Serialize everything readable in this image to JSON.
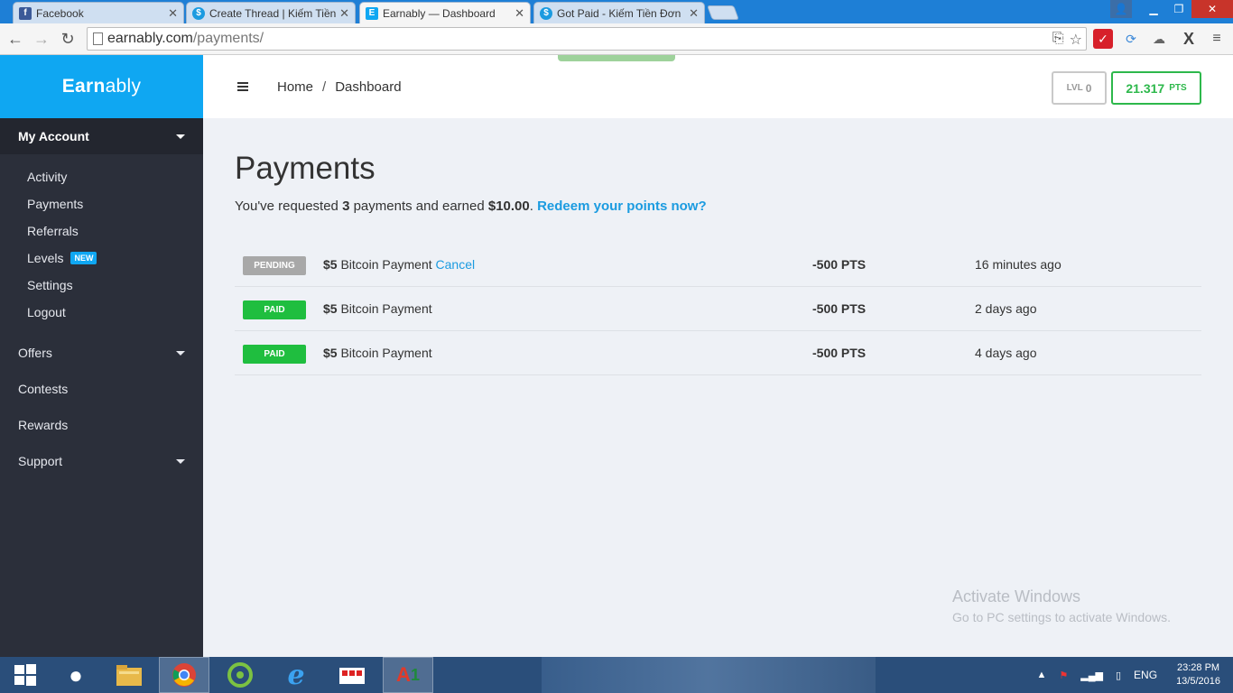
{
  "browser": {
    "tabs": [
      {
        "title": "Facebook",
        "favicon": "facebook-icon",
        "color": "#3b5998",
        "active": false
      },
      {
        "title": "Create Thread | Kiếm Tiền",
        "favicon": "dollar-icon",
        "color": "#1b9be0",
        "active": false
      },
      {
        "title": "Earnably — Dashboard",
        "favicon": "earnably-icon",
        "color": "#0fa7f2",
        "active": true
      },
      {
        "title": "Got Paid - Kiếm Tiền Đơn",
        "favicon": "dollar-icon",
        "color": "#1b9be0",
        "active": false
      }
    ],
    "url_host": "earnably.com",
    "url_path": "/payments/"
  },
  "sidebar": {
    "brand_bold": "Earn",
    "brand_rest": "ably",
    "my_account_label": "My Account",
    "account_items": [
      {
        "label": "Activity"
      },
      {
        "label": "Payments"
      },
      {
        "label": "Referrals"
      },
      {
        "label": "Levels",
        "badge": "NEW"
      },
      {
        "label": "Settings"
      },
      {
        "label": "Logout"
      }
    ],
    "sections": [
      {
        "label": "Offers",
        "has_caret": true
      },
      {
        "label": "Contests",
        "has_caret": false
      },
      {
        "label": "Rewards",
        "has_caret": false
      },
      {
        "label": "Support",
        "has_caret": true
      }
    ]
  },
  "topbar": {
    "breadcrumb_home": "Home",
    "breadcrumb_sep": "/",
    "breadcrumb_current": "Dashboard",
    "level_label": "LVL",
    "level_value": "0",
    "points_value": "21.317",
    "points_label": "PTS"
  },
  "main": {
    "title": "Payments",
    "summary_prefix": "You've requested ",
    "summary_count": "3",
    "summary_middle": " payments and earned ",
    "summary_amount": "$10.00",
    "summary_dot": ". ",
    "redeem_link": "Redeem your points now?",
    "payments": [
      {
        "status": "PENDING",
        "amount": "$5",
        "method": "Bitcoin Payment",
        "action": "Cancel",
        "points": "-500 PTS",
        "time": "16 minutes ago"
      },
      {
        "status": "PAID",
        "amount": "$5",
        "method": "Bitcoin Payment",
        "action": "",
        "points": "-500 PTS",
        "time": "2 days ago"
      },
      {
        "status": "PAID",
        "amount": "$5",
        "method": "Bitcoin Payment",
        "action": "",
        "points": "-500 PTS",
        "time": "4 days ago"
      }
    ]
  },
  "watermark": {
    "line1": "Activate Windows",
    "line2": "Go to PC settings to activate Windows."
  },
  "taskbar": {
    "language": "ENG",
    "time": "23:28 PM",
    "date": "13/5/2016"
  }
}
